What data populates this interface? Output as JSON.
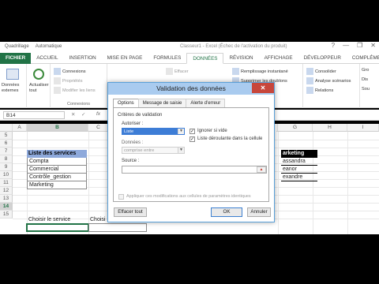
{
  "title_strip": {
    "qat_items": [
      "Quadrillage",
      "Automatique"
    ],
    "document_title": "Classeur1 - Excel (Échec de l'activation du produit)",
    "window_buttons": [
      "?",
      "—",
      "❐",
      "✕"
    ]
  },
  "ribbon_tabs": [
    "FICHIER",
    "ACCUEIL",
    "INSERTION",
    "MISE EN PAGE",
    "FORMULES",
    "DONNÉES",
    "RÉVISION",
    "AFFICHAGE",
    "DÉVELOPPEUR",
    "COMPLÉMENTS"
  ],
  "ribbon": {
    "donnees_externes": "Données externes",
    "actualiser": "Actualiser tout",
    "connexions": "Connexions",
    "proprietes": "Propriétés",
    "modifier_liens": "Modifier les liens",
    "connexions_group": "Connexions",
    "effacer": "Effacer",
    "remplissage": "Remplissage instantané",
    "supprimer_doublons": "Supprimer les doublons",
    "consolider": "Consolider",
    "analyse": "Analyse scénarios",
    "relations": "Relations",
    "grouper": "Gro",
    "dissocier": "Dis",
    "sous_total": "Sou"
  },
  "formula_bar": {
    "name_box": "B14",
    "cancel": "✕",
    "enter": "✓",
    "fx": "fx"
  },
  "grid": {
    "columns": [
      "A",
      "B",
      "C",
      "D",
      "E",
      "F",
      "G",
      "H",
      "I"
    ],
    "rows": [
      "5",
      "6",
      "7",
      "8",
      "9",
      "10",
      "11",
      "12",
      "13",
      "14",
      "15"
    ],
    "services_header": "Liste des services",
    "services": [
      "Compta",
      "Commercial",
      "Contrôle_gestion",
      "Marketing"
    ],
    "marketing_header": "arketing",
    "marketing_names": [
      "assandra",
      "eanor",
      "exandre"
    ],
    "choose_service": "Choisir le service",
    "choose_other": "Choisi"
  },
  "dialog": {
    "title": "Validation des données",
    "close": "✕",
    "tabs": [
      "Options",
      "Message de saisie",
      "Alerte d'erreur"
    ],
    "criteria_label": "Critères de validation",
    "allow_label": "Autoriser :",
    "allow_value": "Liste",
    "ignore_blank": "Ignorer si vide",
    "dropdown_in_cell": "Liste déroulante dans la cellule",
    "data_label": "Données :",
    "data_value": "comprise entre",
    "source_label": "Source :",
    "apply_all": "Appliquer ces modifications aux cellules de paramètres identiques",
    "clear_all": "Effacer tout",
    "ok": "OK",
    "cancel": "Annuler"
  },
  "colors": {
    "excel_green": "#217346",
    "services_header_fill": "#8ea9db",
    "dialog_title_fill": "#a9cbef",
    "close_button_fill": "#c7463b"
  }
}
